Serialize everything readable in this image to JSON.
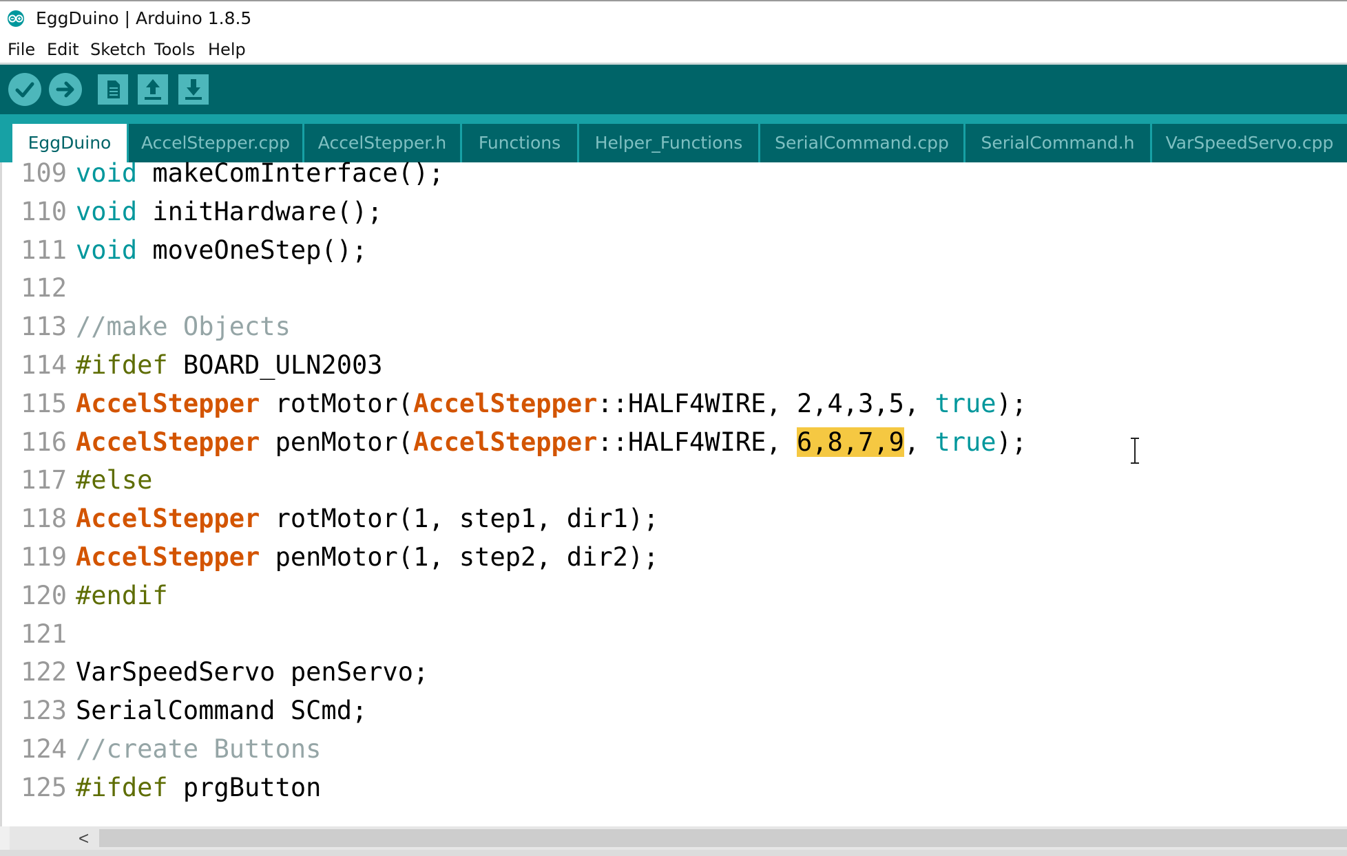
{
  "window": {
    "title": "EggDuino | Arduino 1.8.5"
  },
  "menu": [
    "File",
    "Edit",
    "Sketch",
    "Tools",
    "Help"
  ],
  "toolbar": {
    "buttons": [
      {
        "name": "verify-button",
        "icon": "check-icon"
      },
      {
        "name": "upload-button",
        "icon": "arrow-right-icon"
      },
      {
        "name": "new-button",
        "icon": "document-icon"
      },
      {
        "name": "open-button",
        "icon": "arrow-up-icon"
      },
      {
        "name": "save-button",
        "icon": "arrow-down-icon"
      }
    ]
  },
  "tabs": [
    {
      "label": "EggDuino",
      "active": true
    },
    {
      "label": "AccelStepper.cpp",
      "active": false
    },
    {
      "label": "AccelStepper.h",
      "active": false
    },
    {
      "label": "Functions",
      "active": false
    },
    {
      "label": "Helper_Functions",
      "active": false
    },
    {
      "label": "SerialCommand.cpp",
      "active": false
    },
    {
      "label": "SerialCommand.h",
      "active": false
    },
    {
      "label": "VarSpeedServo.cpp",
      "active": false
    }
  ],
  "editor": {
    "selection": "6,8,7,9",
    "lines": [
      {
        "n": "109",
        "tokens": [
          [
            "kw-type",
            "void"
          ],
          [
            "",
            "makeComInterface();"
          ]
        ]
      },
      {
        "n": "110",
        "tokens": [
          [
            "kw-type",
            "void"
          ],
          [
            "",
            "initHardware();"
          ]
        ]
      },
      {
        "n": "111",
        "tokens": [
          [
            "kw-type",
            "void"
          ],
          [
            "",
            "moveOneStep();"
          ]
        ]
      },
      {
        "n": "112",
        "tokens": []
      },
      {
        "n": "113",
        "tokens": [
          [
            "comment",
            "//make Objects"
          ]
        ]
      },
      {
        "n": "114",
        "tokens": [
          [
            "kw-pp",
            "#ifdef"
          ],
          [
            "",
            " BOARD_ULN2003"
          ]
        ]
      },
      {
        "n": "115",
        "tokens": [
          [
            "kw-class",
            "AccelStepper"
          ],
          [
            "",
            " rotMotor("
          ],
          [
            "kw-class",
            "AccelStepper"
          ],
          [
            "",
            "::HALF4WIRE, 2,4,3,5, "
          ],
          [
            "kw-lit",
            "true"
          ],
          [
            "",
            ");"
          ]
        ]
      },
      {
        "n": "116",
        "tokens": [
          [
            "kw-class",
            "AccelStepper"
          ],
          [
            "",
            " penMotor("
          ],
          [
            "kw-class",
            "AccelStepper"
          ],
          [
            "",
            "::HALF4WIRE, "
          ],
          [
            "sel",
            "6,8,7,9"
          ],
          [
            "",
            ", "
          ],
          [
            "kw-lit",
            "true"
          ],
          [
            "",
            ");"
          ]
        ]
      },
      {
        "n": "117",
        "tokens": [
          [
            "kw-pp",
            "#else"
          ]
        ]
      },
      {
        "n": "118",
        "tokens": [
          [
            "kw-class",
            "AccelStepper"
          ],
          [
            "",
            " rotMotor(1, step1, dir1);"
          ]
        ]
      },
      {
        "n": "119",
        "tokens": [
          [
            "kw-class",
            "AccelStepper"
          ],
          [
            "",
            " penMotor(1, step2, dir2);"
          ]
        ]
      },
      {
        "n": "120",
        "tokens": [
          [
            "kw-pp",
            "#endif"
          ]
        ]
      },
      {
        "n": "121",
        "tokens": []
      },
      {
        "n": "122",
        "tokens": [
          [
            "",
            "VarSpeedServo penServo;"
          ]
        ]
      },
      {
        "n": "123",
        "tokens": [
          [
            "",
            "SerialCommand SCmd;"
          ]
        ]
      },
      {
        "n": "124",
        "tokens": [
          [
            "comment",
            "//create Buttons"
          ]
        ]
      },
      {
        "n": "125",
        "tokens": [
          [
            "kw-pp",
            "#ifdef"
          ],
          [
            "",
            " prgButton"
          ]
        ]
      }
    ]
  },
  "scrollbar": {
    "left_arrow": "<"
  },
  "colors": {
    "toolbar": "#006468",
    "tabbar": "#17a1a5",
    "type_keyword": "#00979c",
    "class_keyword": "#d35400",
    "preprocessor": "#5e6d03",
    "comment": "#95a5a6",
    "selection": "#f5c842"
  }
}
